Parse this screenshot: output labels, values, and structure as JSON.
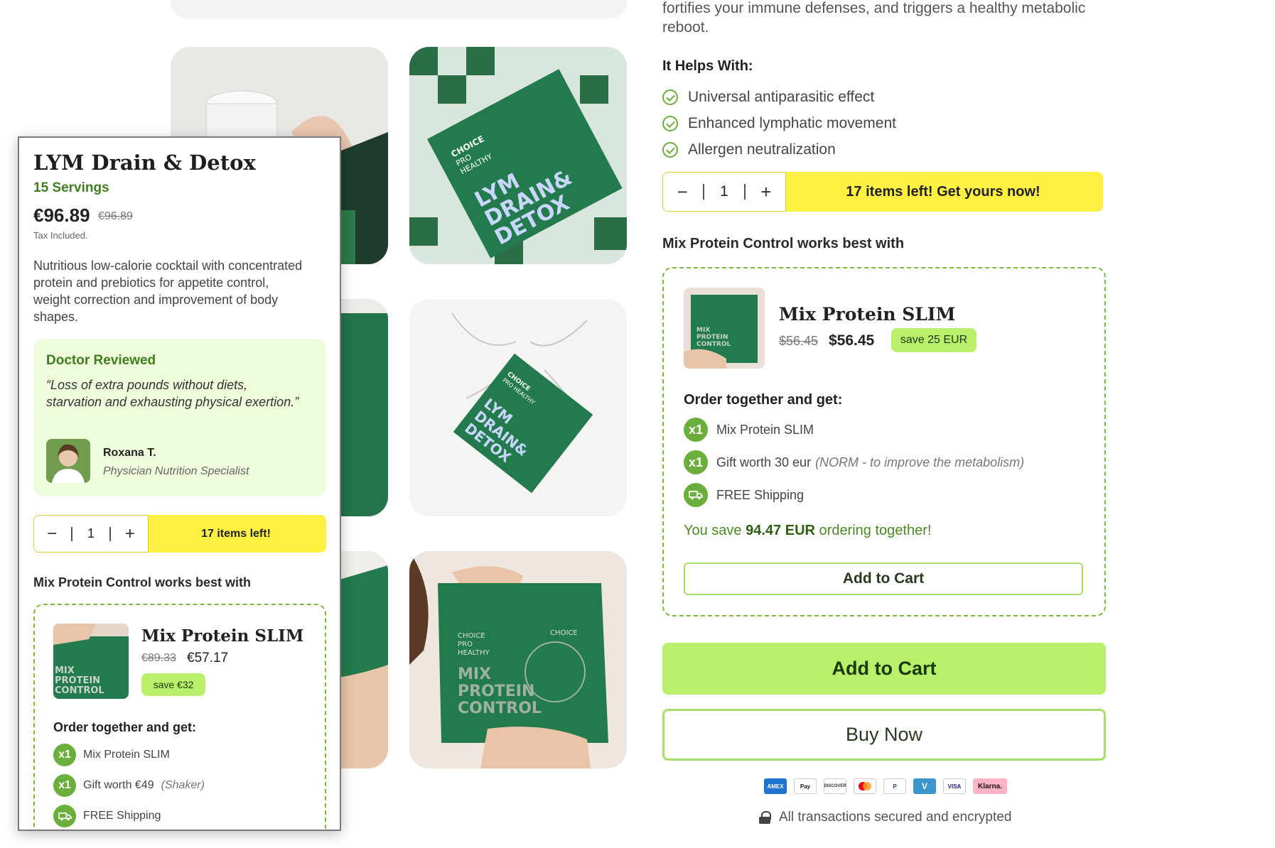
{
  "gallery": {
    "images": [
      {
        "name": "glass-water-photo"
      },
      {
        "name": "lym-box-checker-photo",
        "box_text": [
          "CHOICE",
          "PRO",
          "HEALTHY",
          "LYM",
          "DRAIN&",
          "DETOX"
        ]
      },
      {
        "name": "green-box-side-photo"
      },
      {
        "name": "lym-box-splash-photo",
        "box_text": [
          "CHOICE",
          "PRO",
          "HEALTHY",
          "LYM",
          "DRAIN&",
          "DETOX"
        ]
      },
      {
        "name": "green-pouch-hand-photo"
      },
      {
        "name": "mix-protein-pouch-photo",
        "pouch_text": [
          "CHOICE",
          "PRO",
          "HEALTHY",
          "MIX",
          "PROTEIN",
          "CONTROL"
        ]
      }
    ]
  },
  "product": {
    "description_tail": "fortifies your immune defenses, and triggers a healthy metabolic reboot.",
    "helps_title": "It Helps With:",
    "helps": [
      "Universal antiparasitic effect",
      "Enhanced lymphatic movement",
      "Allergen neutralization"
    ],
    "qty": "1",
    "qty_minus": "−",
    "qty_plus": "+",
    "stock_label": "17 items left! Get yours now!",
    "works_best_title": "Mix Protein Control works best with",
    "bundle": {
      "name": "Mix Protein SLIM",
      "old_price": "$56.45",
      "new_price": "$56.45",
      "save_label": "save 25 EUR",
      "order_title": "Order together and get:",
      "perks": [
        {
          "badge": "x1",
          "label": "Mix Protein SLIM",
          "note": ""
        },
        {
          "badge": "x1",
          "label": "Gift worth 30 eur",
          "note": "(NORM - to improve the metabolism)"
        },
        {
          "badge": "truck-icon",
          "label": "FREE Shipping",
          "note": ""
        }
      ],
      "you_save_prefix": "You save",
      "you_save_amount": "94.47 EUR",
      "you_save_suffix": "ordering together!",
      "add_label": "Add to Cart"
    },
    "add_to_cart": "Add to Cart",
    "buy_now": "Buy Now",
    "payment_methods": [
      "AMEX",
      "Pay",
      "DISCOVER",
      "mastercard",
      "P",
      "V",
      "VISA",
      "Klarna."
    ],
    "secured_text": "All transactions secured and encrypted"
  },
  "popup": {
    "title": "LYM Drain & Detox",
    "servings": "15 Servings",
    "price": "€96.89",
    "compare_price": "€96.89",
    "tax": "Tax Included.",
    "description": "Nutritious low-calorie cocktail with concentrated protein and prebiotics for appetite control, weight correction and improvement of body shapes.",
    "review": {
      "title": "Doctor Reviewed",
      "quote": "“Loss of extra pounds without diets, starvation and exhausting physical exertion.”",
      "name": "Roxana T.",
      "role": "Physician Nutrition Specialist"
    },
    "qty": "1",
    "qty_minus": "−",
    "qty_plus": "+",
    "stock_label": "17 items left!",
    "works_best_title": "Mix Protein Control works best with",
    "bundle": {
      "name": "Mix Protein SLIM",
      "old_price": "€89.33",
      "new_price": "€57.17",
      "save_label": "save €32",
      "order_title": "Order together and get:",
      "perks": [
        {
          "badge": "x1",
          "label": "Mix Protein SLIM",
          "note": ""
        },
        {
          "badge": "x1",
          "label": "Gift worth €49",
          "note": "(Shaker)"
        },
        {
          "badge": "truck-icon",
          "label": "FREE Shipping",
          "note": ""
        }
      ]
    }
  },
  "colors": {
    "accent_green": "#b9ef6a",
    "dark_green": "#3f7d1e",
    "stock_yellow": "#fdf043",
    "package_green": "#2e7a4a"
  }
}
